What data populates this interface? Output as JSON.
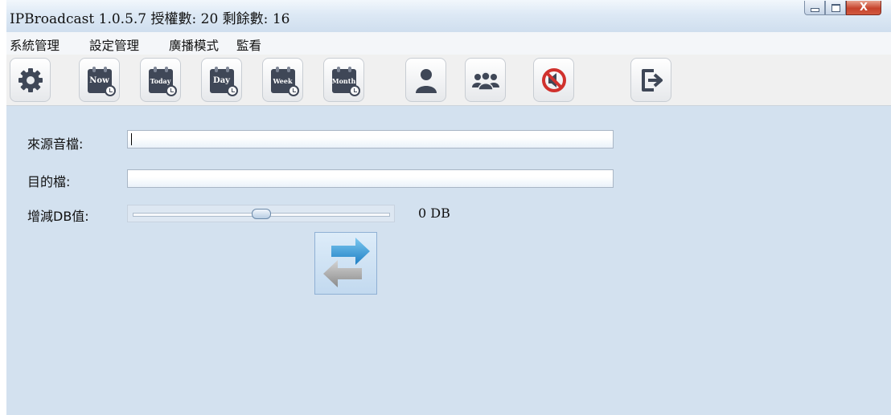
{
  "window": {
    "title": "IPBroadcast 1.0.5.7 授權數: 20 剩餘數: 16",
    "controls": {
      "close_glyph": "X"
    }
  },
  "menu": {
    "items": [
      "系統管理",
      "設定管理",
      "廣播模式",
      "監看"
    ]
  },
  "toolbar": {
    "buttons": [
      {
        "icon": "gear-icon"
      },
      {
        "icon": "calendar-now-icon",
        "label": "Now"
      },
      {
        "icon": "calendar-today-icon",
        "label": "Today"
      },
      {
        "icon": "calendar-day-icon",
        "label": "Day"
      },
      {
        "icon": "calendar-week-icon",
        "label": "Week"
      },
      {
        "icon": "calendar-month-icon",
        "label": "Month"
      },
      {
        "icon": "user-icon"
      },
      {
        "icon": "users-group-icon"
      },
      {
        "icon": "mute-icon"
      },
      {
        "icon": "exit-icon"
      }
    ]
  },
  "form": {
    "source_label": "來源音檔:",
    "source_value": "",
    "dest_label": "目的檔:",
    "dest_value": "",
    "db_label": "增減DB值:",
    "db_value": "0 DB",
    "db_slider_fraction": 0.5
  },
  "actions": {
    "convert_icon": "convert-arrows-icon"
  },
  "colors": {
    "window_bg": "#d3e1ef",
    "arrow_blue": "#2e9ad6",
    "arrow_gray": "#9a9a9a",
    "mute_red": "#d0312d"
  }
}
